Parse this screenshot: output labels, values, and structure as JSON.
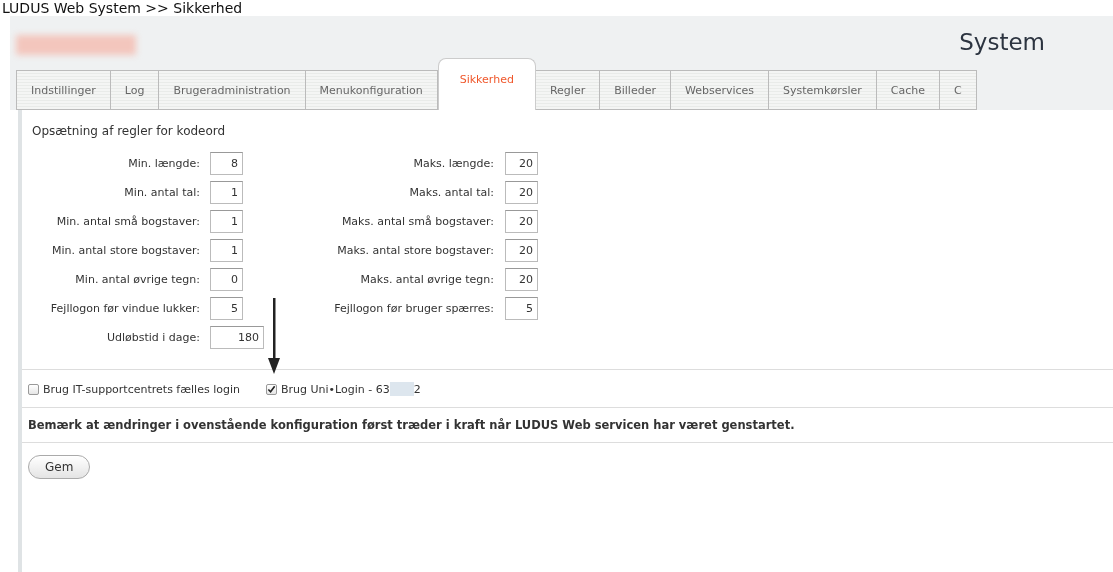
{
  "breadcrumb": "LUDUS Web System >> Sikkerhed",
  "header": {
    "title": "System"
  },
  "tabs": [
    {
      "label": "Indstillinger",
      "selected": false
    },
    {
      "label": "Log",
      "selected": false
    },
    {
      "label": "Brugeradministration",
      "selected": false
    },
    {
      "label": "Menukonfiguration",
      "selected": false
    },
    {
      "label": "Sikkerhed",
      "selected": true
    },
    {
      "label": "Regler",
      "selected": false
    },
    {
      "label": "Billeder",
      "selected": false
    },
    {
      "label": "Webservices",
      "selected": false
    },
    {
      "label": "Systemkørsler",
      "selected": false
    },
    {
      "label": "Cache",
      "selected": false
    },
    {
      "label": "C",
      "selected": false
    }
  ],
  "section_title": "Opsætning af regler for kodeord",
  "left_fields": [
    {
      "label": "Min. længde:",
      "value": "8"
    },
    {
      "label": "Min. antal tal:",
      "value": "1"
    },
    {
      "label": "Min. antal små bogstaver:",
      "value": "1"
    },
    {
      "label": "Min. antal store bogstaver:",
      "value": "1"
    },
    {
      "label": "Min. antal øvrige tegn:",
      "value": "0"
    },
    {
      "label": "Fejllogon før vindue lukker:",
      "value": "5"
    },
    {
      "label": "Udløbstid i dage:",
      "value": "180",
      "kind": "wide"
    }
  ],
  "right_fields": [
    {
      "label": "Maks. længde:",
      "value": "20"
    },
    {
      "label": "Maks. antal tal:",
      "value": "20"
    },
    {
      "label": "Maks. antal små bogstaver:",
      "value": "20"
    },
    {
      "label": "Maks. antal store bogstaver:",
      "value": "20"
    },
    {
      "label": "Maks. antal øvrige tegn:",
      "value": "20"
    },
    {
      "label": "Fejllogon før bruger spærres:",
      "value": "5"
    }
  ],
  "options": [
    {
      "label": "Brug IT-supportcentrets fælles login",
      "checked": false
    },
    {
      "label": "Brug Uni•Login - 63",
      "suffix": "2",
      "checked": true
    }
  ],
  "notice": "Bemærk at ændringer i ovenstående konfiguration først træder i kraft når LUDUS Web servicen har været genstartet.",
  "save_button": "Gem"
}
